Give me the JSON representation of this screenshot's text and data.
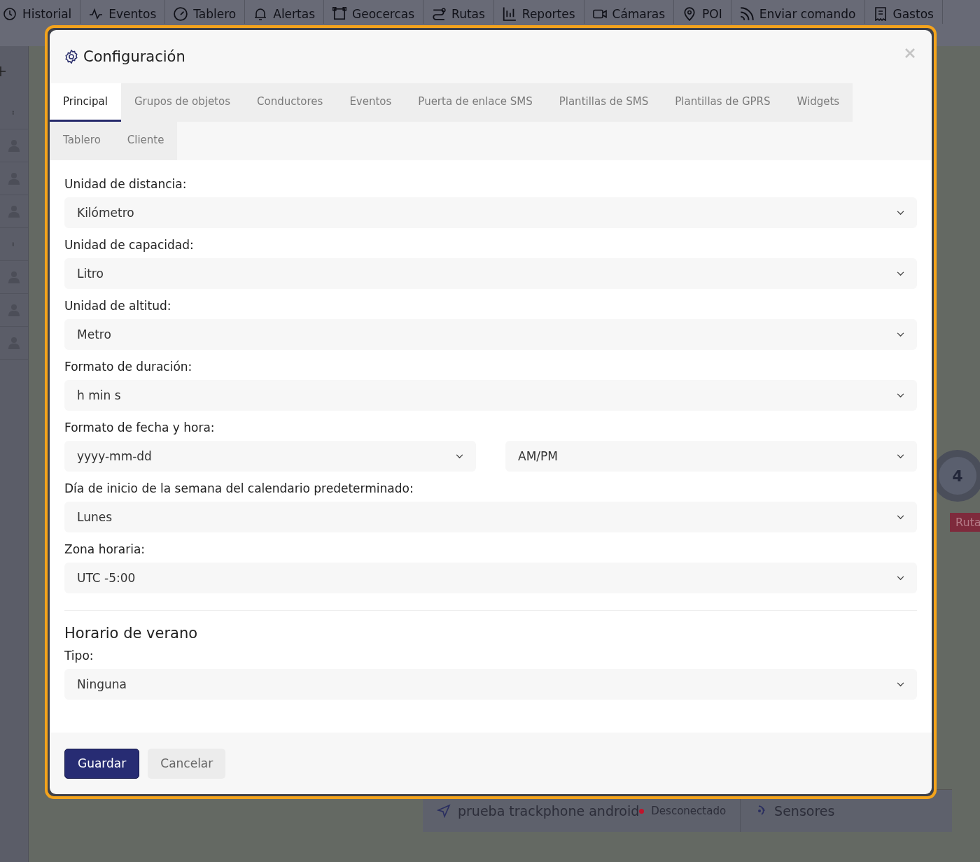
{
  "nav": [
    {
      "label": "Historial"
    },
    {
      "label": "Eventos"
    },
    {
      "label": "Tablero"
    },
    {
      "label": "Alertas"
    },
    {
      "label": "Geocercas"
    },
    {
      "label": "Rutas"
    },
    {
      "label": "Reportes"
    },
    {
      "label": "Cámaras"
    },
    {
      "label": "POI"
    },
    {
      "label": "Enviar comando"
    },
    {
      "label": "Gastos"
    }
  ],
  "sidebar": {
    "items": [
      {
        "kind": "menu"
      },
      {
        "kind": "user"
      },
      {
        "kind": "user"
      },
      {
        "kind": "user"
      },
      {
        "kind": "menu"
      },
      {
        "kind": "user"
      },
      {
        "kind": "user"
      },
      {
        "kind": "user"
      }
    ]
  },
  "map": {
    "cluster": "4",
    "route_badge": "Ruta"
  },
  "bottom_bar": {
    "device": "prueba trackphone android",
    "status": "Desconectado",
    "sensors": "Sensores"
  },
  "dialog": {
    "title": "Configuración",
    "tabs": [
      {
        "label": "Principal",
        "selected": true
      },
      {
        "label": "Grupos de objetos",
        "selected": false
      },
      {
        "label": "Conductores",
        "selected": false
      },
      {
        "label": "Eventos",
        "selected": false
      },
      {
        "label": "Puerta de enlace SMS",
        "selected": false
      },
      {
        "label": "Plantillas de SMS",
        "selected": false
      },
      {
        "label": "Plantillas de GPRS",
        "selected": false
      },
      {
        "label": "Widgets",
        "selected": false
      },
      {
        "label": "Tablero",
        "selected": false
      },
      {
        "label": "Cliente",
        "selected": false
      }
    ],
    "fields": [
      {
        "label": "Unidad de distancia:",
        "values": [
          "Kilómetro"
        ]
      },
      {
        "label": "Unidad de capacidad:",
        "values": [
          "Litro"
        ]
      },
      {
        "label": "Unidad de altitud:",
        "values": [
          "Metro"
        ]
      },
      {
        "label": "Formato de duración:",
        "values": [
          "h min s"
        ]
      },
      {
        "label": "Formato de fecha y hora:",
        "values": [
          "yyyy-mm-dd",
          "AM/PM"
        ]
      },
      {
        "label": "Día de inicio de la semana del calendario predeterminado:",
        "values": [
          "Lunes"
        ]
      },
      {
        "label": "Zona horaria:",
        "values": [
          "UTC -5:00"
        ]
      }
    ],
    "section": {
      "title": "Horario de verano",
      "fields": [
        {
          "label": "Tipo:",
          "values": [
            "Ninguna"
          ]
        }
      ]
    },
    "buttons": [
      {
        "label": "Guardar",
        "kind": "primary"
      },
      {
        "label": "Cancelar",
        "kind": "secondary"
      }
    ]
  }
}
